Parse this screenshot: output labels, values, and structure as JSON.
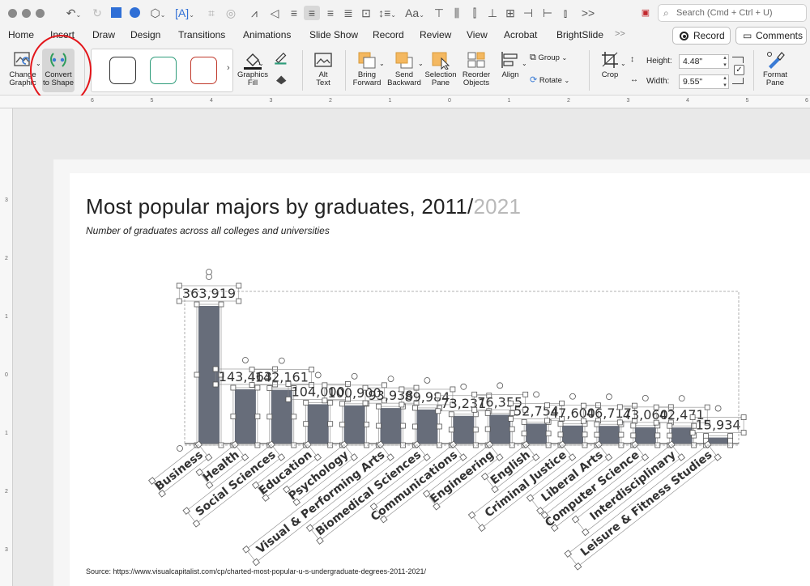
{
  "window": {
    "search_placeholder": "Search (Cmd + Ctrl + U)"
  },
  "tabs": [
    {
      "label": "Home"
    },
    {
      "label": "Insert"
    },
    {
      "label": "Draw"
    },
    {
      "label": "Design"
    },
    {
      "label": "Transitions"
    },
    {
      "label": "Animations"
    },
    {
      "label": "Slide Show"
    },
    {
      "label": "Record"
    },
    {
      "label": "Review"
    },
    {
      "label": "View"
    },
    {
      "label": "Acrobat"
    },
    {
      "label": "BrightSlide"
    }
  ],
  "tabs_more": ">>",
  "qat_more": ">>",
  "header_buttons": {
    "record": "Record",
    "comments": "Comments"
  },
  "ribbon": {
    "change_graphic": [
      "Change",
      "Graphic"
    ],
    "convert_to_shape": [
      "Convert",
      "to Shape"
    ],
    "graphics_fill": [
      "Graphics",
      "Fill"
    ],
    "alt_text": [
      "Alt",
      "Text"
    ],
    "bring_forward": [
      "Bring",
      "Forward"
    ],
    "send_backward": [
      "Send",
      "Backward"
    ],
    "selection_pane": [
      "Selection",
      "Pane"
    ],
    "reorder_objects": [
      "Reorder",
      "Objects"
    ],
    "align": "Align",
    "group": "Group",
    "rotate": "Rotate",
    "crop": "Crop",
    "height_label": "Height:",
    "height_value": "4.48\"",
    "width_label": "Width:",
    "width_value": "9.55\"",
    "format_pane": [
      "Format",
      "Pane"
    ]
  },
  "ruler_h": [
    "6",
    "5",
    "4",
    "3",
    "2",
    "1",
    "0",
    "1",
    "2",
    "3",
    "4",
    "5",
    "6"
  ],
  "ruler_v": [
    "3",
    "2",
    "1",
    "0",
    "1",
    "2",
    "3"
  ],
  "slide": {
    "title_main": "Most popular majors by graduates, 2011/",
    "title_year": "2021",
    "subtitle": "Number of graduates across all colleges and universities",
    "source": "Source: https://www.visualcapitalist.com/cp/charted-most-popular-u-s-undergraduate-degrees-2011-2021/"
  },
  "colors": {
    "bar": "#676d7a",
    "selection_handle": "#555555",
    "highlight_circle": "#e3151a"
  },
  "chart_data": {
    "type": "bar",
    "categories": [
      "Business",
      "Health",
      "Social Sciences",
      "Education",
      "Psychology",
      "Visual & Performing Arts",
      "Biomedical Sciences",
      "Communications",
      "Engineering",
      "English",
      "Criminal Justice",
      "Liberal Arts",
      "Computer Science",
      "Interdisciplinary",
      "Leisure & Fitness Studies"
    ],
    "values": [
      363919,
      143463,
      142161,
      104000,
      100900,
      93938,
      89984,
      73231,
      76355,
      52754,
      47600,
      46717,
      43060,
      42471,
      15934
    ],
    "value_labels": [
      "363,919",
      "143,463",
      "142,161",
      "104,000",
      "100,900",
      "93,938",
      "89,984",
      "73,231",
      "76,355",
      "52,754",
      "47,600",
      "46,717",
      "43,060",
      "42,471",
      "15,934"
    ],
    "ylim": [
      0,
      380000
    ]
  }
}
